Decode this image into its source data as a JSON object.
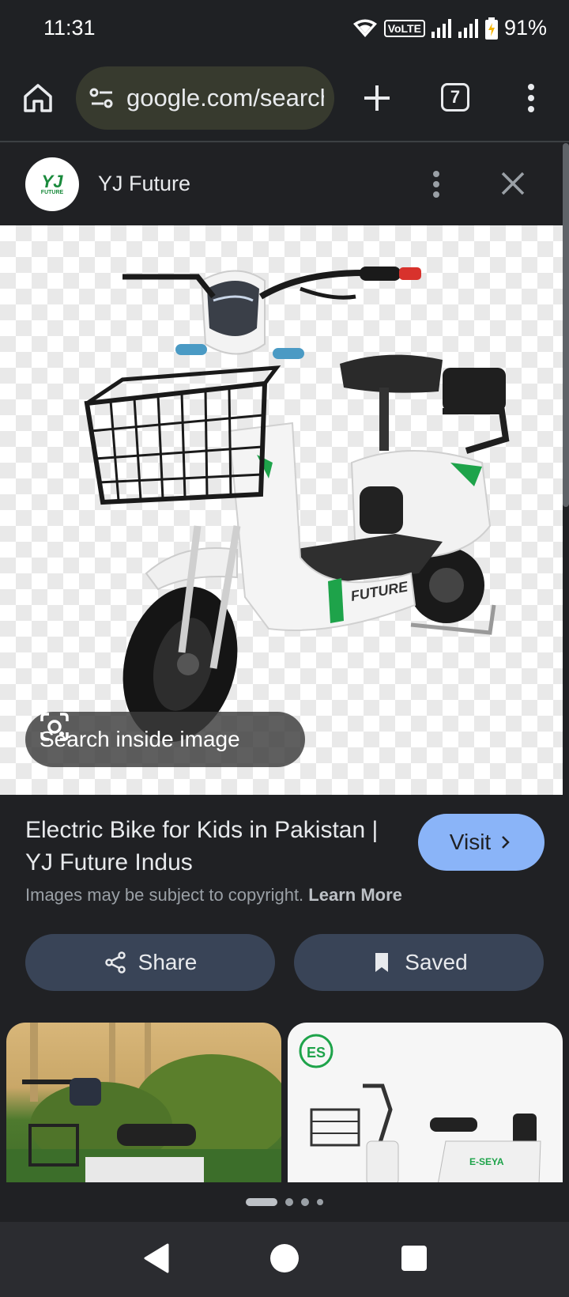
{
  "status_bar": {
    "time": "11:31",
    "network_badge": "VoLTE",
    "battery": "91%",
    "icons": [
      "wifi-icon",
      "signal-icon",
      "signal-icon",
      "battery-charging-icon"
    ]
  },
  "browser": {
    "url": "google.com/search",
    "tab_count": "7",
    "icons": [
      "home-icon",
      "tune-icon",
      "plus-icon",
      "tabs-icon",
      "more-vert-icon"
    ]
  },
  "panel": {
    "source_name": "YJ Future",
    "logo_text": "YJ",
    "logo_subtext": "FUTURE",
    "icons": [
      "more-vert-icon",
      "close-icon"
    ]
  },
  "image_viewer": {
    "lens_label": "Search inside image",
    "brand_on_bike": "FUTURE"
  },
  "result": {
    "title": "Electric Bike for Kids in Pakistan | YJ Future Indus",
    "visit_label": "Visit",
    "copyright_text": "Images may be subject to copyright.",
    "learn_more": "Learn More",
    "share_label": "Share",
    "saved_label": "Saved"
  },
  "related": {
    "thumb_b_brand": "E-SEYA"
  },
  "pager": {
    "count": 4,
    "active": 0
  },
  "colors": {
    "background": "#202124",
    "visit_button": "#8ab4f8",
    "pill_button": "#394457",
    "omnibox": "#373a2e"
  }
}
